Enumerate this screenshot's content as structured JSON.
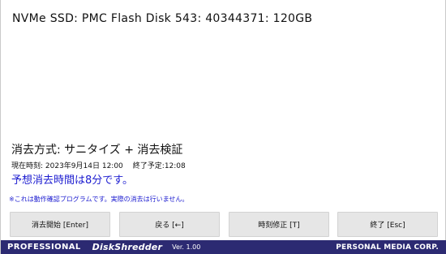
{
  "device": {
    "title": "NVMe SSD: PMC Flash Disk 543: 40344371: 120GB"
  },
  "erase": {
    "method": "消去方式: サニタイズ + 消去検証",
    "current_time": "現在時刻: 2023年9月14日 12:00",
    "end_time": "終了予定:12:08",
    "estimate": "予想消去時間は8分です。",
    "notice": "※これは動作確認プログラムです。実際の消去は行いません。"
  },
  "buttons": {
    "start": "消去開始 [Enter]",
    "back": "戻る [←]",
    "time_adjust": "時刻修正 [T]",
    "quit": "終了 [Esc]"
  },
  "footer": {
    "brand": "PROFESSIONAL",
    "product": "DiskShredder",
    "version": "Ver. 1.00",
    "company": "PERSONAL MEDIA CORP."
  },
  "colors": {
    "accent_text": "#1c1cd0",
    "footer_bg": "#2c2a72",
    "button_bg": "#e6e6e6"
  }
}
